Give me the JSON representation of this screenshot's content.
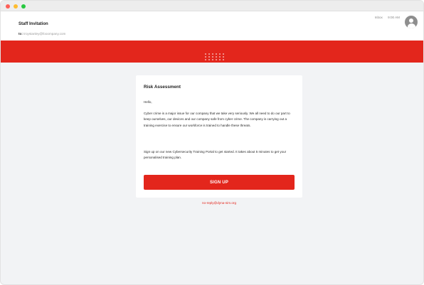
{
  "window": {
    "controls": [
      "close",
      "minimize",
      "zoom"
    ]
  },
  "header": {
    "subject": "Staff Invitation",
    "to_label": "to:",
    "to_address": "troystanley@fooompany.com",
    "folder": "Inbox",
    "time": "9:00 AM"
  },
  "email": {
    "title": "Risk Assessment",
    "greeting": "Hello,",
    "paragraph_1": "Cyber crime is a major issue for our company that we take very seriously. We all need to do our part to keep ourselves, our devices and our company safe from cyber crime. The company is carrying out a training exercise to ensure our workforce is trained to handle these threats.",
    "paragraph_2": "Sign up on our new Cybersecurity Training Portal to get started. It takes about 5 minutes to get your personalised training plan.",
    "button_label": "SIGN UP",
    "sender_address": "no-reply@dyna-nim.org"
  },
  "colors": {
    "accent": "#e3261c",
    "background": "#f2f3f5",
    "card": "#ffffff"
  },
  "icons": {
    "avatar": "user-avatar-icon",
    "logo": "dotted-logo-icon"
  }
}
